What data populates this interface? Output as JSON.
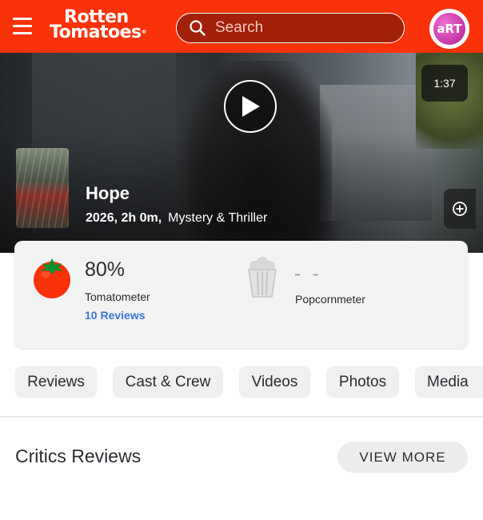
{
  "header": {
    "logo_line1": "Rotten",
    "logo_line2": "Tomatoes",
    "logo_mark": "®",
    "search_placeholder": "Search",
    "avatar_text": "aRT"
  },
  "hero": {
    "duration": "1:37",
    "title": "Hope",
    "year_runtime": "2026, 2h 0m,",
    "genre": "Mystery & Thriller"
  },
  "scores": {
    "tomatometer_value": "80%",
    "tomatometer_label": "Tomatometer",
    "reviews_link": "10 Reviews",
    "popcornmeter_value": "- -",
    "popcornmeter_label": "Popcornmeter"
  },
  "tabs": [
    {
      "label": "Reviews"
    },
    {
      "label": "Cast & Crew"
    },
    {
      "label": "Videos"
    },
    {
      "label": "Photos"
    },
    {
      "label": "Media"
    }
  ],
  "section": {
    "title": "Critics Reviews",
    "view_more": "VIEW MORE"
  },
  "colors": {
    "brand": "#fa320a",
    "link": "#3976dc"
  }
}
